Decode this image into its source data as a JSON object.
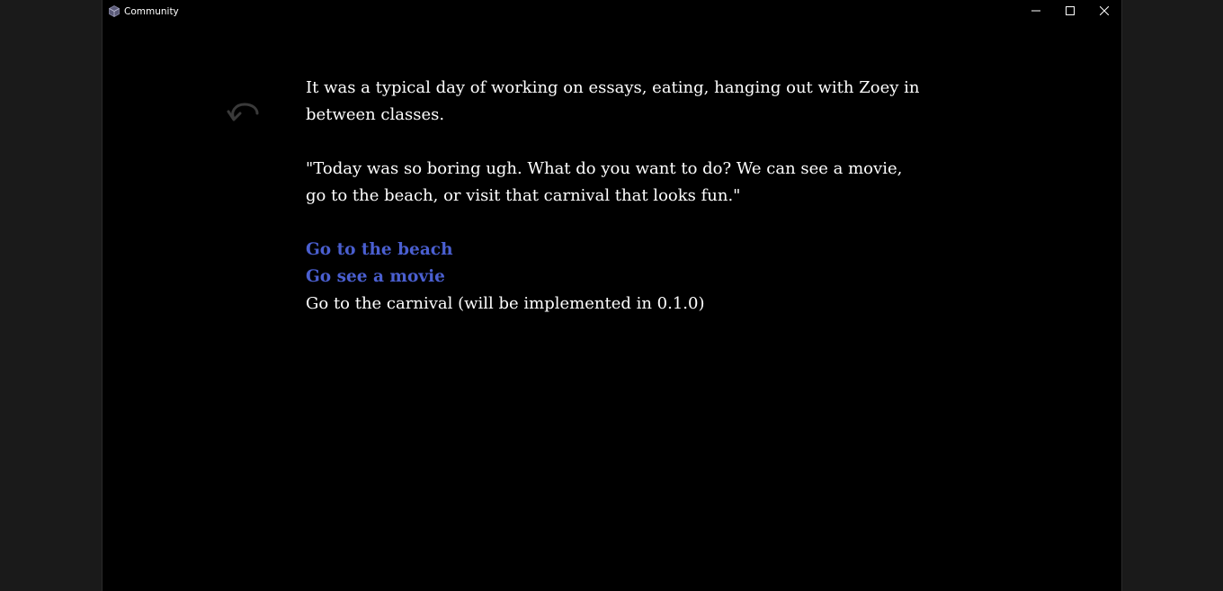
{
  "window": {
    "title": "Community",
    "icon": "app-cube-icon",
    "controls": [
      "minimize-icon",
      "maximize-icon",
      "close-icon"
    ]
  },
  "toolbar": {
    "undo_icon": "undo-arrow-icon"
  },
  "story": {
    "paragraphs": [
      "It was a typical day of working on essays, eating, hanging out with Zoey in between classes.",
      "\"Today was so boring ugh. What do you want to do? We can see a movie, go to the beach, or visit that carnival that looks fun.\""
    ],
    "choices": [
      {
        "label": "Go to the beach",
        "enabled": true
      },
      {
        "label": "Go see a movie",
        "enabled": true
      },
      {
        "label": "Go to the carnival (will be implemented in 0.1.0)",
        "enabled": false
      }
    ]
  },
  "colors": {
    "background": "#000000",
    "text": "#ffffff",
    "link": "#4a5fd0",
    "undo_icon": "#3a3a3a"
  }
}
